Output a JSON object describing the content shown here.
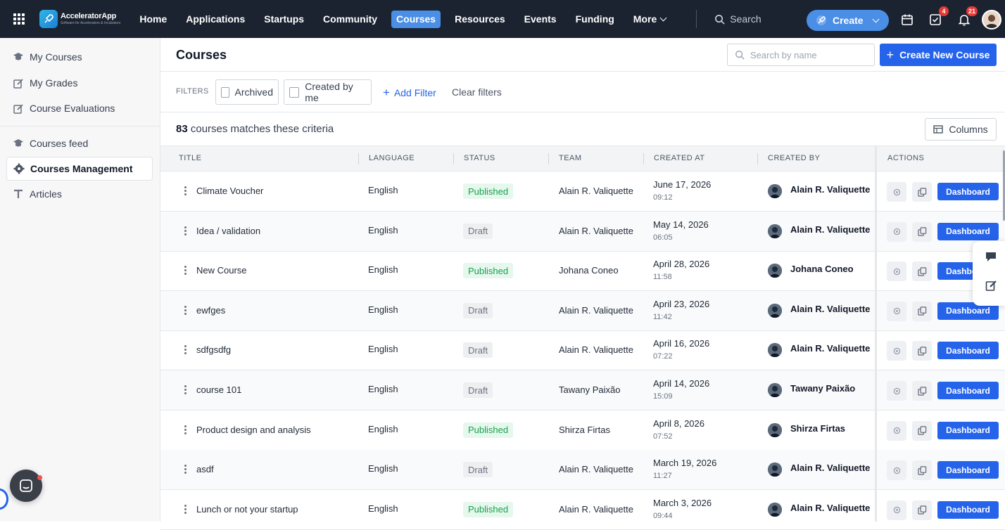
{
  "app": {
    "name": "AcceleratorApp",
    "tagline": "Software for Accelerators & Incubators"
  },
  "nav": {
    "items": [
      {
        "label": "Home"
      },
      {
        "label": "Applications"
      },
      {
        "label": "Startups"
      },
      {
        "label": "Community"
      },
      {
        "label": "Courses",
        "active": true
      },
      {
        "label": "Resources"
      },
      {
        "label": "Events"
      },
      {
        "label": "Funding"
      },
      {
        "label": "More"
      }
    ],
    "search_label": "Search",
    "create_label": "Create",
    "tasks_badge": "4",
    "notifications_badge": "21"
  },
  "sidebar": {
    "items": [
      {
        "label": "My Courses",
        "icon": "graduation-cap-icon"
      },
      {
        "label": "My Grades",
        "icon": "edit-icon"
      },
      {
        "label": "Course Evaluations",
        "icon": "edit-icon"
      },
      {
        "label": "Courses feed",
        "icon": "graduation-cap-icon"
      },
      {
        "label": "Courses Management",
        "icon": "gear-icon",
        "active": true
      },
      {
        "label": "Articles",
        "icon": "text-icon"
      }
    ]
  },
  "page": {
    "title": "Courses",
    "search_placeholder": "Search by name",
    "create_button": "Create New Course",
    "filters_label": "FILTERS",
    "filter_archived": "Archived",
    "filter_created_by_me": "Created by me",
    "add_filter": "Add Filter",
    "clear_filters": "Clear filters",
    "count": "83",
    "count_suffix": "courses matches these criteria",
    "columns_button": "Columns"
  },
  "table": {
    "headers": {
      "title": "TITLE",
      "language": "LANGUAGE",
      "status": "STATUS",
      "team": "TEAM",
      "created_at": "CREATED AT",
      "created_by": "CREATED BY",
      "actions": "ACTIONS"
    },
    "dashboard_label": "Dashboard",
    "rows": [
      {
        "title": "Climate Voucher",
        "language": "English",
        "status": "Published",
        "team": "Alain R. Valiquette",
        "date": "June 17, 2026",
        "time": "09:12",
        "creator": "Alain R. Valiquette"
      },
      {
        "title": "Idea / validation",
        "language": "English",
        "status": "Draft",
        "team": "Alain R. Valiquette",
        "date": "May 14, 2026",
        "time": "06:05",
        "creator": "Alain R. Valiquette"
      },
      {
        "title": "New Course",
        "language": "English",
        "status": "Published",
        "team": "Johana Coneo",
        "date": "April 28, 2026",
        "time": "11:58",
        "creator": "Johana Coneo"
      },
      {
        "title": "ewfges",
        "language": "English",
        "status": "Draft",
        "team": "Alain R. Valiquette",
        "date": "April 23, 2026",
        "time": "11:42",
        "creator": "Alain R. Valiquette"
      },
      {
        "title": "sdfgsdfg",
        "language": "English",
        "status": "Draft",
        "team": "Alain R. Valiquette",
        "date": "April 16, 2026",
        "time": "07:22",
        "creator": "Alain R. Valiquette"
      },
      {
        "title": "course 101",
        "language": "English",
        "status": "Draft",
        "team": "Tawany Paixão",
        "date": "April 14, 2026",
        "time": "15:09",
        "creator": "Tawany Paixão"
      },
      {
        "title": "Product design and analysis",
        "language": "English",
        "status": "Published",
        "team": "Shirza Firtas",
        "date": "April 8, 2026",
        "time": "07:52",
        "creator": "Shirza Firtas"
      },
      {
        "title": "asdf",
        "language": "English",
        "status": "Draft",
        "team": "Alain R. Valiquette",
        "date": "March 19, 2026",
        "time": "11:27",
        "creator": "Alain R. Valiquette"
      },
      {
        "title": "Lunch or not your startup",
        "language": "English",
        "status": "Published",
        "team": "Alain R. Valiquette",
        "date": "March 3, 2026",
        "time": "09:44",
        "creator": "Alain R. Valiquette"
      }
    ]
  },
  "colors": {
    "topbar": "#1b2331",
    "accent": "#2563eb",
    "published": "#16a34a"
  }
}
